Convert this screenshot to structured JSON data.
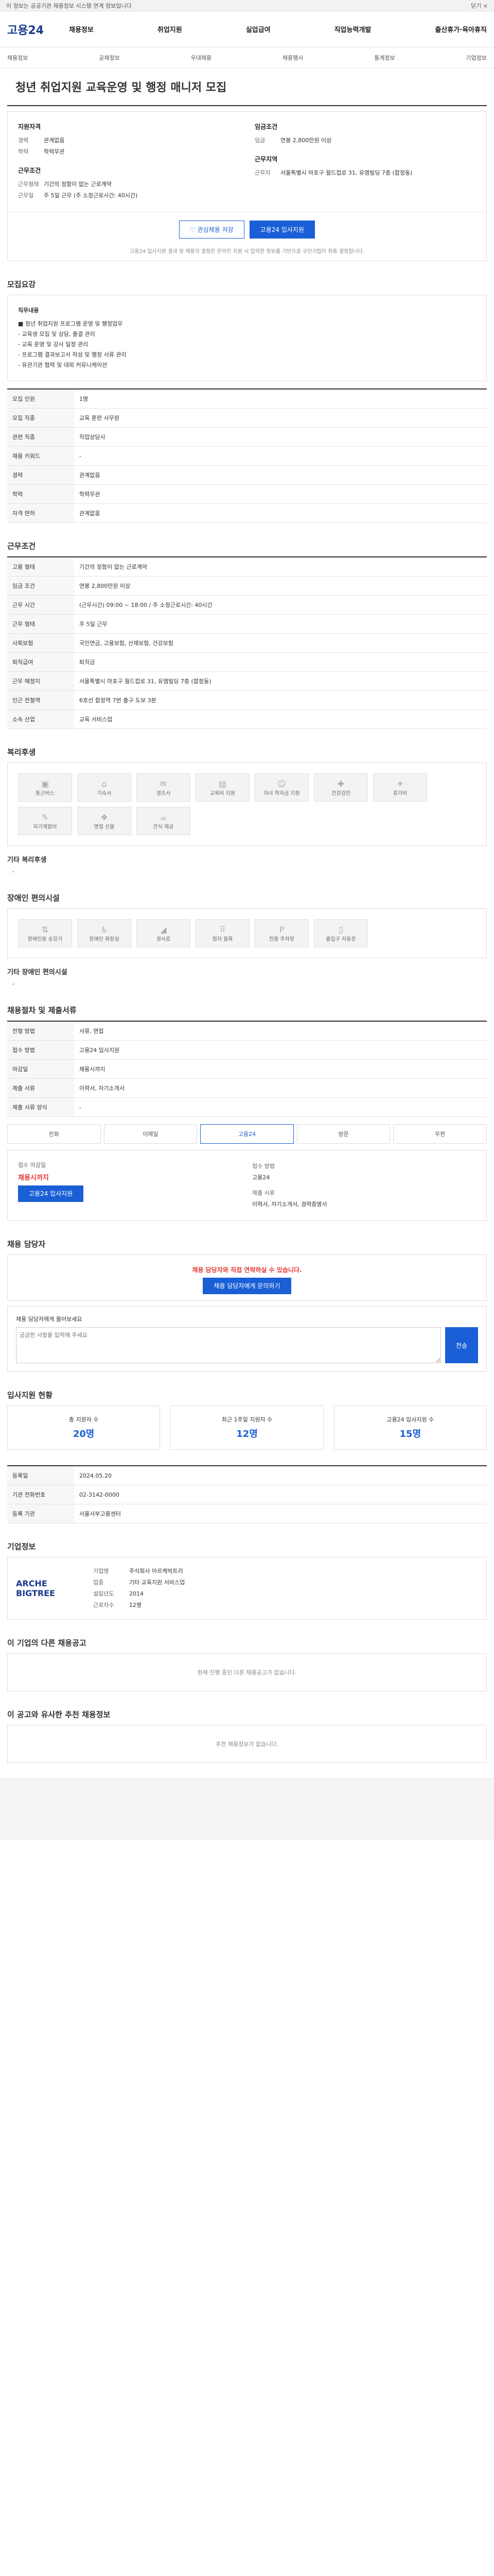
{
  "topbar": {
    "text": "이 정보는 공공기관 채용정보 시스템 연계 정보입니다",
    "close": "닫기 ×"
  },
  "header": {
    "logo": "고용24",
    "gnb": [
      "채용정보",
      "취업지원",
      "실업급여",
      "직업능력개발",
      "출산휴가·육아휴직"
    ]
  },
  "subnav": [
    "채용정보",
    "공채정보",
    "우대채용",
    "채용행사",
    "통계정보",
    "기업정보"
  ],
  "title": "청년 취업지원 교육운영 및 행정 매니저 모집",
  "summary": {
    "left_title": "지원자격",
    "left": [
      {
        "k": "경력",
        "v": "관계없음"
      },
      {
        "k": "학력",
        "v": "학력무관"
      }
    ],
    "left2_title": "근무조건",
    "left2": [
      {
        "k": "근무형태",
        "v": "기간의 정함이 없는 근로계약"
      },
      {
        "k": "근무일",
        "v": "주 5일 근무 (주 소정근로시간: 40시간)"
      }
    ],
    "right_title": "임금조건",
    "right": [
      {
        "k": "임금",
        "v": "연봉 2,800만원 이상"
      }
    ],
    "right2_title": "근무지역",
    "right2": [
      {
        "k": "근무지",
        "v": "서울특별시 마포구 월드컵로 31, 유엠빌딩 7층 (합정동)"
      }
    ]
  },
  "buttons": {
    "scrap": "관심채용 저장",
    "apply": "고용24 입사지원"
  },
  "notice": "고용24 입사지원 결과 및 채용의 결정은 온라인 지원 시 입력한 정보를 기반으로 구인기업이 최종 결정합니다.",
  "sections": {
    "recruit": "모집요강",
    "work": "근무조건",
    "welfare": "복리후생",
    "disability": "장애인 편의시설",
    "apply": "채용절차 및 제출서류",
    "contact": "채용 담당자",
    "status": "입사지원 현황",
    "org": "기업정보",
    "other": "이 기업의 다른 채용공고",
    "recommend": "이 공고와 유사한 추천 채용정보"
  },
  "duty": {
    "title": "직무내용",
    "lines": [
      "■ 청년 취업지원 프로그램 운영 및 행정업무",
      "- 교육생 모집 및 상담, 출결 관리",
      "- 교육 운영 및 강사 일정 관리",
      "- 프로그램 결과보고서 작성 및 행정 서류 관리",
      "- 유관기관 협력 및 대외 커뮤니케이션"
    ]
  },
  "recruit_table": [
    {
      "k": "모집 인원",
      "v": "1명"
    },
    {
      "k": "모집 직종",
      "v": "교육 훈련 사무원"
    },
    {
      "k": "관련 직종",
      "v": "직업상담사"
    },
    {
      "k": "채용 키워드",
      "v": "-"
    },
    {
      "k": "경력",
      "v": "관계없음"
    },
    {
      "k": "학력",
      "v": "학력무관"
    },
    {
      "k": "자격 면허",
      "v": "관계없음"
    }
  ],
  "work_table": [
    {
      "k": "고용 형태",
      "v": "기간의 정함이 없는 근로계약"
    },
    {
      "k": "임금 조건",
      "v": "연봉 2,800만원 이상"
    },
    {
      "k": "근무 시간",
      "v": "(근무시간) 09:00 ~ 18:00 / 주 소정근로시간: 40시간"
    },
    {
      "k": "근무 형태",
      "v": "주 5일 근무"
    },
    {
      "k": "사회보험",
      "v": "국민연금, 고용보험, 산재보험, 건강보험"
    },
    {
      "k": "퇴직급여",
      "v": "퇴직금"
    },
    {
      "k": "근무 예정지",
      "v": "서울특별시 마포구 월드컵로 31, 유엠빌딩 7층 (합정동)"
    },
    {
      "k": "인근 전철역",
      "v": "6호선 합정역 7번 출구 도보 3분"
    },
    {
      "k": "소속 산업",
      "v": "교육 서비스업"
    }
  ],
  "welfare": {
    "icons": [
      "통근버스",
      "기숙사",
      "경조사",
      "교육비 지원",
      "자녀 학자금 지원",
      "건강검진",
      "휴가비",
      "자기계발비",
      "명절 선물",
      "간식 제공"
    ],
    "extra_title": "기타 복리후생",
    "extra": "-"
  },
  "disability": {
    "icons": [
      "장애인용 승강기",
      "장애인 화장실",
      "경사로",
      "점자 블록",
      "전용 주차장",
      "출입구 자동문"
    ],
    "extra_title": "기타 장애인 편의시설",
    "extra": "-"
  },
  "apply_table": [
    {
      "k": "전형 방법",
      "v": "서류, 면접"
    },
    {
      "k": "접수 방법",
      "v": "고용24 입사지원"
    },
    {
      "k": "마감일",
      "v": "채용시까지"
    },
    {
      "k": "제출 서류",
      "v": "이력서, 자기소개서"
    },
    {
      "k": "제출 서류 양식",
      "v": "-"
    }
  ],
  "apply_box": {
    "tabs": [
      "전화",
      "이메일",
      "고용24",
      "방문",
      "우편"
    ],
    "deadline_label": "접수 마감일",
    "deadline": "채용시까지",
    "method_label": "접수 방법",
    "method": "고용24",
    "docs_label": "제출 서류",
    "docs": "이력서, 자기소개서, 경력증명서",
    "apply_btn": "고용24 입사지원"
  },
  "contact": {
    "alert": "채용 담당자와 직접 연락하실 수 있습니다.",
    "btn": "채용 담당자에게 문의하기",
    "q_label": "채용 담당자에게 물어보세요",
    "q_placeholder": "궁금한 사항을 입력해 주세요",
    "q_submit": "전송"
  },
  "status": {
    "items": [
      {
        "label": "총 지원자 수",
        "value": "20명"
      },
      {
        "label": "최근 1주일 지원자 수",
        "value": "12명"
      },
      {
        "label": "고용24 입사지원 수",
        "value": "15명"
      }
    ]
  },
  "agency_table": [
    {
      "k": "등록일",
      "v": "2024.05.20"
    },
    {
      "k": "기관 전화번호",
      "v": "02-3142-0000"
    },
    {
      "k": "등록 기관",
      "v": "서울서부고용센터"
    }
  ],
  "org": {
    "logo": "ARCHE BIGTREE",
    "rows": [
      {
        "k": "기업명",
        "v": "주식회사 아르케빅트리"
      },
      {
        "k": "업종",
        "v": "기타 교육지원 서비스업"
      },
      {
        "k": "설립년도",
        "v": "2014"
      },
      {
        "k": "근로자수",
        "v": "12명"
      }
    ]
  },
  "other_empty": "현재 진행 중인 다른 채용공고가 없습니다.",
  "recommend_empty": "추천 채용정보가 없습니다."
}
